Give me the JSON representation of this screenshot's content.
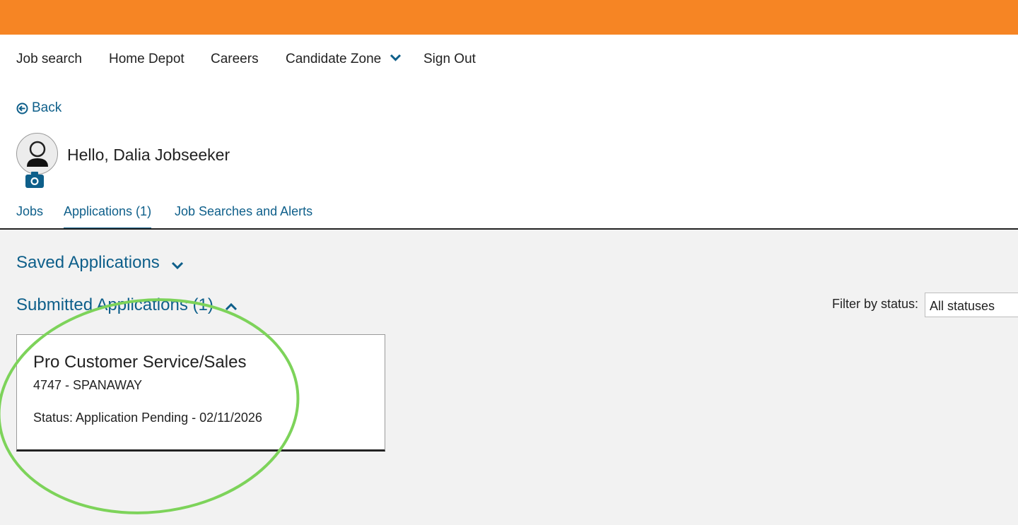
{
  "nav": {
    "items": [
      "Job search",
      "Home Depot",
      "Careers",
      "Candidate Zone",
      "Sign Out"
    ]
  },
  "back_label": "Back",
  "profile": {
    "greeting": "Hello, Dalia Jobseeker"
  },
  "tabs": [
    {
      "label": "Jobs"
    },
    {
      "label": "Applications (1)"
    },
    {
      "label": "Job Searches and Alerts"
    }
  ],
  "saved_section": {
    "title": "Saved Applications"
  },
  "submitted_section": {
    "title": "Submitted Applications (1)"
  },
  "filter": {
    "label": "Filter by status:",
    "selected": "All statuses"
  },
  "application": {
    "title": "Pro Customer Service/Sales",
    "location": "4747 - SPANAWAY",
    "status": "Status: Application Pending - 02/11/2026"
  },
  "colors": {
    "brand_orange": "#f68524",
    "link_blue": "#0e5f8a",
    "highlight_green": "#7dd35a"
  },
  "icons": [
    "chevron-down-icon",
    "back-arrow-icon",
    "avatar-icon",
    "camera-icon",
    "chevron-up-icon"
  ]
}
